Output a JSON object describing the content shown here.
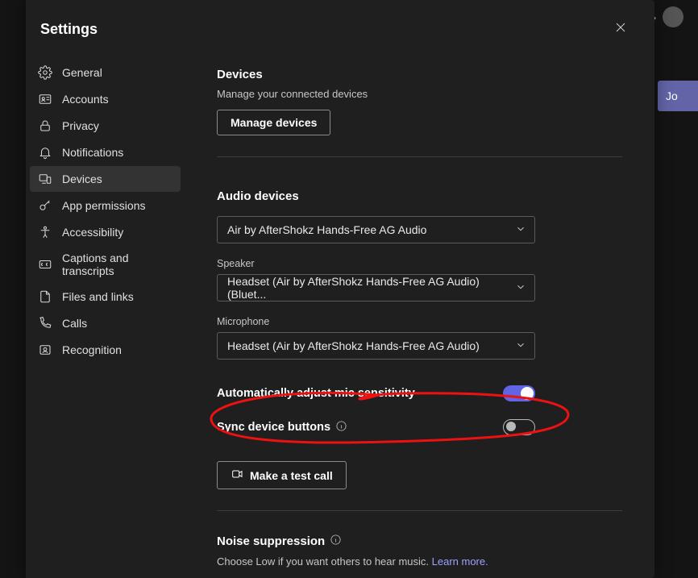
{
  "app": {
    "title": "Settings"
  },
  "bg": {
    "join_label": "Jo"
  },
  "sidebar": {
    "items": [
      {
        "id": "general",
        "label": "General"
      },
      {
        "id": "accounts",
        "label": "Accounts"
      },
      {
        "id": "privacy",
        "label": "Privacy"
      },
      {
        "id": "notifications",
        "label": "Notifications"
      },
      {
        "id": "devices",
        "label": "Devices",
        "active": true
      },
      {
        "id": "apppermissions",
        "label": "App permissions"
      },
      {
        "id": "accessibility",
        "label": "Accessibility"
      },
      {
        "id": "captions",
        "label": "Captions and transcripts"
      },
      {
        "id": "files",
        "label": "Files and links"
      },
      {
        "id": "calls",
        "label": "Calls"
      },
      {
        "id": "recognition",
        "label": "Recognition"
      }
    ]
  },
  "devices": {
    "section_title": "Devices",
    "section_sub": "Manage your connected devices",
    "manage_btn": "Manage devices",
    "audio_title": "Audio devices",
    "audio_select": "Air by AfterShokz Hands-Free AG Audio",
    "speaker_label": "Speaker",
    "speaker_select": "Headset (Air by AfterShokz Hands-Free AG Audio) (Bluet...",
    "mic_label": "Microphone",
    "mic_select": "Headset (Air by AfterShokz Hands-Free AG Audio)",
    "auto_mic_label": "Automatically adjust mic sensitivity",
    "sync_label": "Sync device buttons",
    "test_call_btn": "Make a test call",
    "noise_title": "Noise suppression",
    "noise_sub_prefix": "Choose Low if you want others to hear music. ",
    "noise_learn": "Learn more."
  }
}
